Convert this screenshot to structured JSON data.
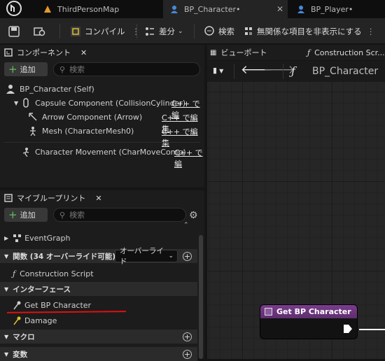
{
  "tabs": [
    {
      "label": "ThirdPersonMap",
      "icon": "map-icon"
    },
    {
      "label": "BP_Character•",
      "icon": "blueprint-icon"
    },
    {
      "label": "BP_Player•",
      "icon": "blueprint-icon"
    }
  ],
  "toolbar": {
    "compile": "コンパイル",
    "diff": "差分",
    "search": "検索",
    "hide_unrelated": "無関係な項目を非表示にする"
  },
  "components": {
    "title": "コンポーネント",
    "add": "追加",
    "search_placeholder": "検索",
    "root": "BP_Character (Self)",
    "items": [
      {
        "label": "Capsule Component (CollisionCylinder)",
        "link": "C++ で編"
      },
      {
        "label": "Arrow Component (Arrow)",
        "link": "C++ で編集"
      },
      {
        "label": "Mesh (CharacterMesh0)",
        "link": "C++ で編集"
      },
      {
        "label": "Character Movement (CharMoveComp)",
        "link": "C++ で編"
      }
    ]
  },
  "mybp": {
    "title": "マイブループリント",
    "add": "追加",
    "search_placeholder": "検索",
    "event_graph": "EventGraph",
    "functions_header": "関数 (34 オーバーライド可能)",
    "override": "オーバーライド",
    "construction_script": "Construction Script",
    "interfaces_header": "インターフェース",
    "get_bp_character": "Get BP Character",
    "damage": "Damage",
    "macros_header": "マクロ",
    "variables_header": "変数"
  },
  "viewport_tabs": {
    "viewport": "ビューポート",
    "construction": "Construction Scr..."
  },
  "graph": {
    "breadcrumb": "BP_Character",
    "node_title": "Get BP Character"
  },
  "colors": {
    "node_header": "#7a3d8c",
    "underline": "#e01010",
    "add_green": "#5fc05f"
  }
}
